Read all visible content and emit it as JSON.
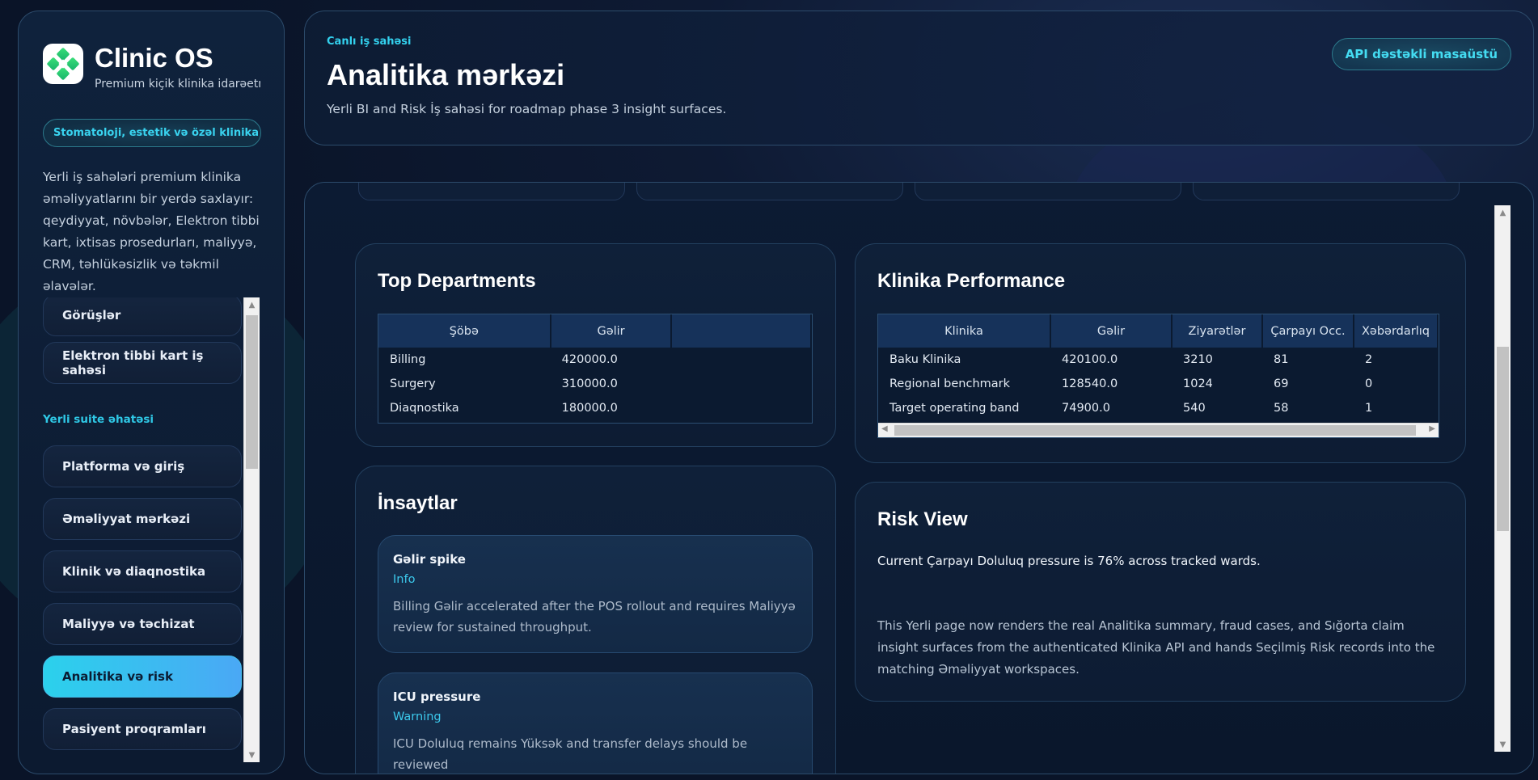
{
  "sidebar": {
    "brand_title": "Clinic OS",
    "brand_subtitle": "Premium kiçik klinika idarəetmə",
    "scope_pill": "Stomatoloji, estetik və özəl klinika iş axını",
    "description": "Yerli iş sahələri premium klinika əməliyyatlarını bir yerdə saxlayır: qeydiyyat, növbələr, Elektron tibbi kart, ixtisas prosedurları, maliyyə, CRM, təhlükəsizlik və təkmil əlavələr.",
    "items": [
      {
        "label": "Görüşlər"
      },
      {
        "label": "Elektron tibbi kart iş sahəsi"
      }
    ],
    "section_label": "Yerli suite əhatəsi",
    "suite_items": [
      {
        "label": "Platforma və giriş"
      },
      {
        "label": "Əməliyyat mərkəzi"
      },
      {
        "label": "Klinik və diaqnostika"
      },
      {
        "label": "Maliyyə və təchizat"
      },
      {
        "label": "Analitika və risk"
      },
      {
        "label": "Pasiyent proqramları"
      }
    ]
  },
  "header": {
    "eyebrow": "Canlı iş sahəsi",
    "title": "Analitika mərkəzi",
    "subtitle": "Yerli BI and Risk İş sahəsi for roadmap phase 3 insight surfaces.",
    "api_pill": "API dəstəkli masaüstü"
  },
  "top_departments": {
    "title": "Top Departments",
    "columns": [
      "Şöbə",
      "Gəlir",
      ""
    ],
    "rows": [
      [
        "Billing",
        "420000.0",
        ""
      ],
      [
        "Surgery",
        "310000.0",
        ""
      ],
      [
        "Diaqnostika",
        "180000.0",
        ""
      ]
    ]
  },
  "klinika_performance": {
    "title": "Klinika Performance",
    "columns": [
      "Klinika",
      "Gəlir",
      "Ziyarətlər",
      "Çarpayı Occ.",
      "Xəbərdarlıq"
    ],
    "rows": [
      [
        "Baku Klinika",
        "420100.0",
        "3210",
        "81",
        "2"
      ],
      [
        "Regional benchmark",
        "128540.0",
        "1024",
        "69",
        "0"
      ],
      [
        "Target operating band",
        "74900.0",
        "540",
        "58",
        "1"
      ]
    ]
  },
  "insights": {
    "title": "İnsaytlar",
    "items": [
      {
        "title": "Gəlir spike",
        "severity": "Info",
        "body": "Billing Gəlir accelerated after the POS rollout and requires Maliyyə review for sustained throughput."
      },
      {
        "title": "ICU pressure",
        "severity": "Warning",
        "body": "ICU Doluluq remains Yüksək and transfer delays should be reviewed"
      }
    ]
  },
  "risk_view": {
    "title": "Risk View",
    "summary": "Current Çarpayı Doluluq pressure is 76% across tracked wards.",
    "body": "This Yerli page now renders the real Analitika summary, fraud cases, and Sığorta claim insight surfaces from the authenticated Klinika API and hands Seçilmiş Risk records into the matching Əməliyyat workspaces."
  },
  "colors": {
    "accent": "#2bd1ec",
    "background": "#0a1428",
    "card": "#0f2039",
    "header_cell": "#16325a"
  },
  "icons": {
    "logo": "clinic-logo-icon"
  }
}
